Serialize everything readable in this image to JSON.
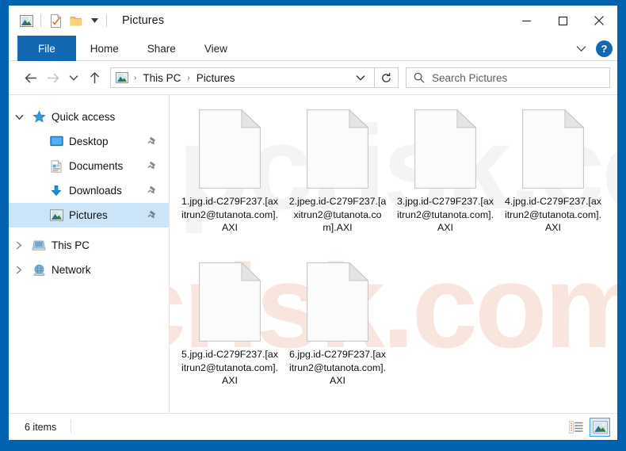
{
  "window": {
    "title": "Pictures",
    "quick_access_toolbar": [
      {
        "name": "pictures-icon",
        "label": "Pictures"
      },
      {
        "name": "properties-icon",
        "label": "Properties"
      },
      {
        "name": "new-folder-icon",
        "label": "New folder"
      },
      {
        "name": "customize-chevron-icon",
        "label": "Customize Quick Access Toolbar"
      }
    ],
    "controls": [
      {
        "name": "minimize-button",
        "label": "Minimize"
      },
      {
        "name": "maximize-button",
        "label": "Maximize"
      },
      {
        "name": "close-button",
        "label": "Close"
      }
    ]
  },
  "ribbon": {
    "tabs": [
      {
        "label": "File",
        "active": true
      },
      {
        "label": "Home",
        "active": false
      },
      {
        "label": "Share",
        "active": false
      },
      {
        "label": "View",
        "active": false
      }
    ],
    "expand_label": "Expand the Ribbon",
    "help_label": "?"
  },
  "address_bar": {
    "back_label": "Back",
    "forward_label": "Forward",
    "recent_label": "Recent locations",
    "up_label": "Up",
    "breadcrumb": [
      "This PC",
      "Pictures"
    ],
    "breadcrumb_sep": "›",
    "refresh_label": "Refresh"
  },
  "search": {
    "placeholder": "Search Pictures",
    "value": ""
  },
  "sidebar": {
    "items": [
      {
        "label": "Quick access",
        "icon": "star-icon",
        "level": 0,
        "twisty": "down",
        "pinned": false,
        "selected": false
      },
      {
        "label": "Desktop",
        "icon": "desktop-icon",
        "level": 1,
        "twisty": "",
        "pinned": true,
        "selected": false
      },
      {
        "label": "Documents",
        "icon": "documents-icon",
        "level": 1,
        "twisty": "",
        "pinned": true,
        "selected": false
      },
      {
        "label": "Downloads",
        "icon": "downloads-icon",
        "level": 1,
        "twisty": "",
        "pinned": true,
        "selected": false
      },
      {
        "label": "Pictures",
        "icon": "pictures-icon",
        "level": 1,
        "twisty": "",
        "pinned": true,
        "selected": true
      },
      {
        "label": "This PC",
        "icon": "computer-icon",
        "level": 0,
        "twisty": "right",
        "pinned": false,
        "selected": false
      },
      {
        "label": "Network",
        "icon": "network-icon",
        "level": 0,
        "twisty": "right",
        "pinned": false,
        "selected": false
      }
    ]
  },
  "files": [
    {
      "name": "1.jpg.id-C279F237.[axitrun2@tutanota.com].AXI",
      "icon": "blank-file-icon"
    },
    {
      "name": "2.jpeg.id-C279F237.[axitrun2@tutanota.com].AXI",
      "icon": "blank-file-icon"
    },
    {
      "name": "3.jpg.id-C279F237.[axitrun2@tutanota.com].AXI",
      "icon": "blank-file-icon"
    },
    {
      "name": "4.jpg.id-C279F237.[axitrun2@tutanota.com].AXI",
      "icon": "blank-file-icon"
    },
    {
      "name": "5.jpg.id-C279F237.[axitrun2@tutanota.com].AXI",
      "icon": "blank-file-icon"
    },
    {
      "name": "6.jpg.id-C279F237.[axitrun2@tutanota.com].AXI",
      "icon": "blank-file-icon"
    }
  ],
  "status_bar": {
    "item_count_text": "6 items",
    "view_details_label": "Details view",
    "view_large_icons_label": "Large icons view",
    "active_view": "large-icons"
  },
  "watermark": {
    "text": "pcrisk.com"
  },
  "colors": {
    "window_frame_blue": "#0063b1",
    "file_tab_blue": "#1268b3",
    "selection_blue": "#cce4f7",
    "accent_help_blue": "#1268b3",
    "watermark_peach": "#f6ded3"
  }
}
